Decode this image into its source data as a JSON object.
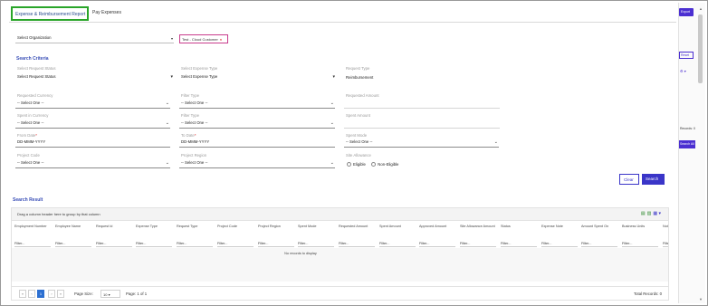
{
  "tabs": [
    {
      "label": "Expense & Reimbursement Report"
    },
    {
      "label": "Pay Expenses"
    }
  ],
  "right_panel": {
    "top_button": "Export",
    "reset_label": "Reset",
    "records_label": "Records: 0",
    "all_label": "Search All"
  },
  "org": {
    "label": "Select Organization",
    "chip_label": "Test - Cloud Customer",
    "chip_remove": "×"
  },
  "search_criteria": {
    "title": "Search Criteria",
    "select_request_status_label": "Select Request Status",
    "select_request_status_value": "Select Request Status",
    "select_expense_type_label": "Select Expense Type",
    "select_expense_type_value": "Select Expense Type",
    "request_type_label": "Request Type",
    "request_type_value": "Reimbursement",
    "requested_currency_label": "Requested Currency",
    "requested_currency_value": "-- Select One --",
    "filter_type_label_1": "Filter Type",
    "filter_type_value_1": "-- Select One --",
    "requested_amount_label": "Requested Amount",
    "spent_in_currency_label": "Spent in Currency",
    "spent_in_currency_value": "-- Select One --",
    "filter_type_label_2": "Filter Type",
    "filter_type_value_2": "-- Select One --",
    "spent_amount_label": "Spent Amount",
    "from_date_label": "From Date",
    "from_date_value": "DD-MMM-YYYY",
    "to_date_label": "To Date",
    "to_date_value": "DD-MMM-YYYY",
    "spent_mode_label": "Spent Mode",
    "spent_mode_value": "-- Select One --",
    "project_code_label": "Project Code",
    "project_code_value": "-- Select One --",
    "project_region_label": "Project Region",
    "project_region_value": "-- Select One --",
    "site_allowance_label": "Site Allowance",
    "site_allowance_options": [
      "Eligible",
      "Non-Eligible"
    ],
    "required_mark": "*",
    "clear_label": "Clear",
    "search_label": "Search"
  },
  "result": {
    "title": "Search Result",
    "drag_hint": "Drag a column header here to group by that column",
    "columns": [
      "Employment Number",
      "Employee Name",
      "Request Id",
      "Expense Type",
      "Request Type",
      "Project Code",
      "Project Region",
      "Spent Mode",
      "Requested Amount",
      "Spent Amount",
      "Approved Amount",
      "Site Allowance Amount",
      "Status",
      "Expense Note",
      "Amount Spent On",
      "Business Units",
      "Note"
    ],
    "filter_label": "Filter...",
    "no_records": "No records to display"
  },
  "pager": {
    "first": "«",
    "prev": "‹",
    "current": "1",
    "next": "›",
    "last": "»",
    "page_size_label": "Page Size:",
    "page_size_value": "10",
    "page_info": "Page: 1 of 1",
    "total_records": "Total Records: 0"
  },
  "colors": {
    "accent": "#3a35c8",
    "tab_highlight": "#2aa52a",
    "section_title": "#3a4fb7",
    "chip_border": "#c83c8c"
  }
}
